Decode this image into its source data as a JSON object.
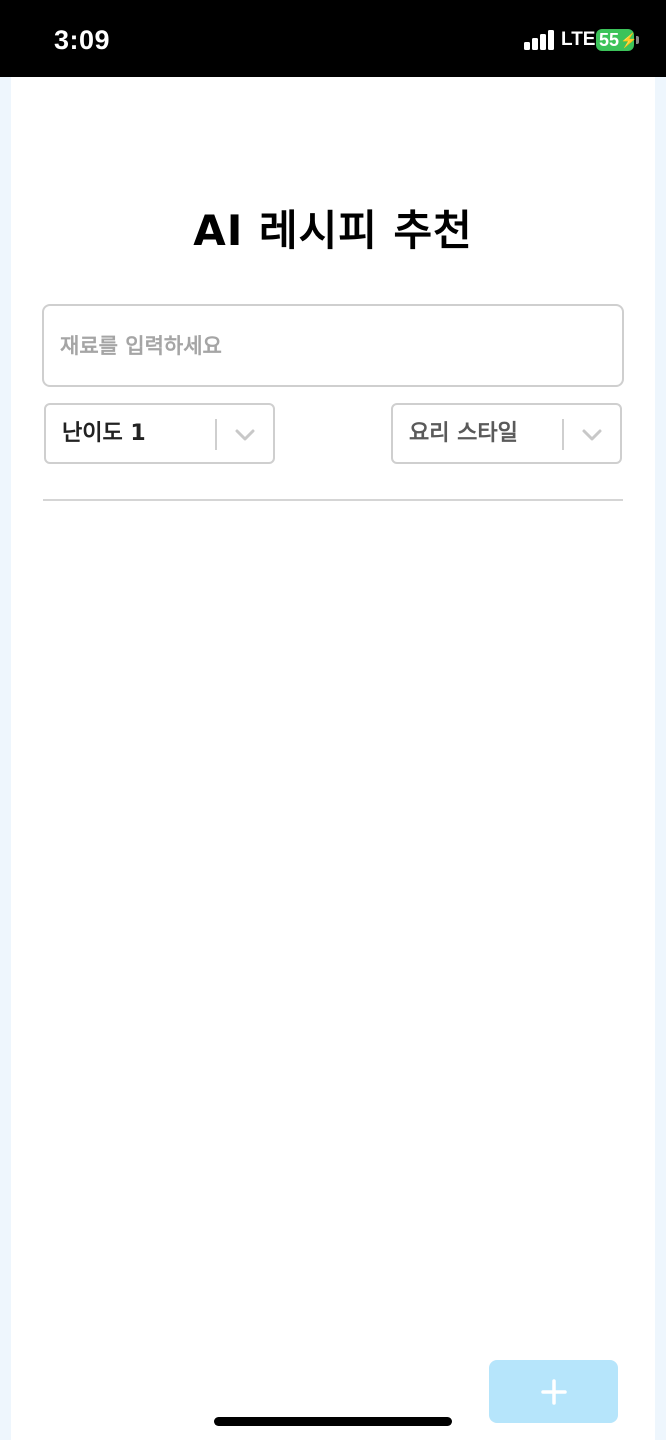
{
  "status_bar": {
    "time": "3:09",
    "network": "LTE",
    "battery_level": "55",
    "battery_charging_glyph": "⚡",
    "signal_bars": 4,
    "icons": [
      "signal-bars-icon",
      "battery-charging-icon"
    ]
  },
  "header": {
    "title": "AI 레시피 추천"
  },
  "ingredients": {
    "placeholder": "재료를 입력하세요",
    "value": ""
  },
  "filters": {
    "difficulty": {
      "selected": "난이도 1"
    },
    "style": {
      "placeholder": "요리 스타일"
    }
  },
  "actions": {
    "add_glyph": "+"
  },
  "colors": {
    "status_bar_bg": "#000000",
    "battery_green": "#3cc35a",
    "page_bg": "#eef6fd",
    "card_bg": "#ffffff",
    "input_border": "#cfcfcf",
    "placeholder_text": "#a5a5a5",
    "selected_text": "#222222",
    "style_placeholder_text": "#5a5a5a",
    "add_button_bg": "#b6e5fb"
  }
}
